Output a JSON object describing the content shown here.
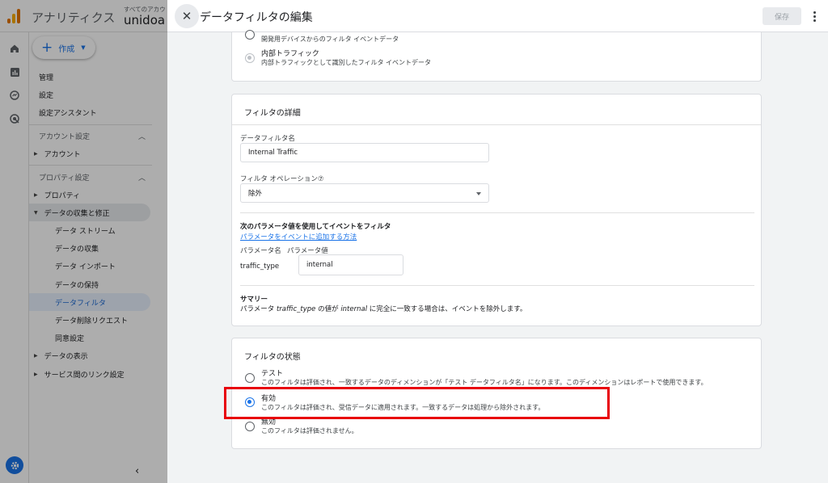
{
  "app": {
    "name": "アナリティクス",
    "account_small": "すべてのアカウ",
    "account_name": "unidoa -"
  },
  "sidebar": {
    "create_label": "作成",
    "items": {
      "admin": "管理",
      "settings": "設定",
      "setup_assistant": "設定アシスタント",
      "account_settings": "アカウント設定",
      "account": "アカウント",
      "property_settings": "プロパティ設定",
      "property": "プロパティ",
      "data_collection": "データの収集と修正",
      "data_streams": "データ ストリーム",
      "data_collection_leaf": "データの収集",
      "data_import": "データ インポート",
      "data_retention": "データの保持",
      "data_filters": "データフィルタ",
      "data_deletion": "データ削除リクエスト",
      "consent": "同意設定",
      "data_display": "データの表示",
      "product_links": "サービス間のリンク設定"
    }
  },
  "drawer": {
    "title": "データフィルタの編集",
    "save_label": "保存"
  },
  "top_card": {
    "opt1_desc": "開発用デバイスからのフィルタ イベントデータ",
    "opt2_label": "内部トラフィック",
    "opt2_desc": "内部トラフィックとして識別したフィルタ イベントデータ"
  },
  "details": {
    "title": "フィルタの詳細",
    "name_label": "データフィルタ名",
    "name_value": "Internal Traffic",
    "operation_label": "フィルタ オペレーション",
    "operation_value": "除外",
    "param_heading": "次のパラメータ値を使用してイベントをフィルタ",
    "param_link": "パラメータをイベントに追加する方法",
    "param_name_label": "パラメータ名",
    "param_value_label": "パラメータ値",
    "param_name": "traffic_type",
    "param_value": "internal",
    "summary_heading": "サマリー",
    "summary_pre": "パラメータ ",
    "summary_param": "traffic_type",
    "summary_mid": " の値が ",
    "summary_value": "internal",
    "summary_post": " に完全に一致する場合は、イベントを除外します。"
  },
  "status": {
    "title": "フィルタの状態",
    "options": [
      {
        "label": "テスト",
        "desc": "このフィルタは評価され、一致するデータのディメンションが「テスト データフィルタ名」になります。このディメンションはレポートで使用できます。"
      },
      {
        "label": "有効",
        "desc": "このフィルタは評価され、受信データに適用されます。一致するデータは処理から除外されます。"
      },
      {
        "label": "無効",
        "desc": "このフィルタは評価されません。"
      }
    ],
    "selected": "有効"
  }
}
